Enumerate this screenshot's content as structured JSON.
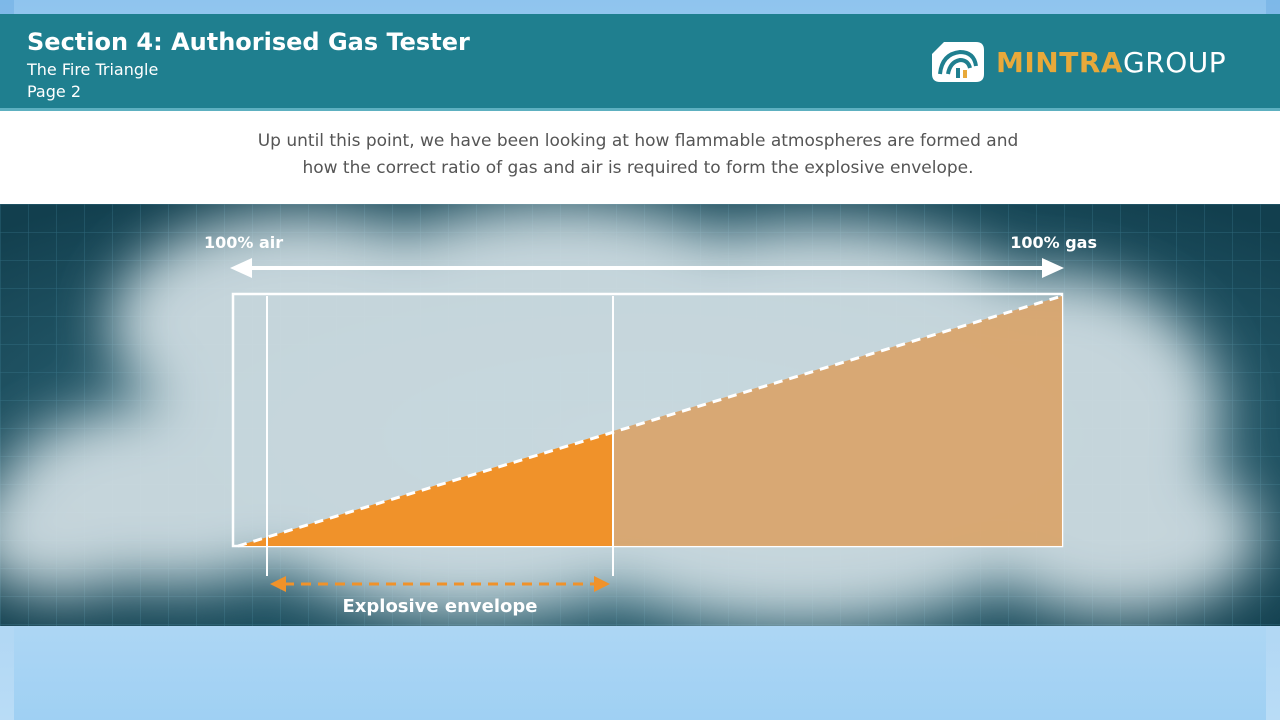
{
  "header": {
    "title": "Section 4: Authorised Gas Tester",
    "subtitle": "The Fire Triangle",
    "page": "Page 2"
  },
  "logo": {
    "part1": "MINTRA",
    "part2": "GROUP",
    "part1_color": "#e8a93a",
    "part2_color": "#ffffff"
  },
  "intro": {
    "line1": "Up until this point, we have been looking at how flammable atmospheres are formed and",
    "line2": "how the correct ratio of gas and air is required to form the explosive envelope."
  },
  "diagram": {
    "left_label": "100% air",
    "right_label": "100% gas",
    "envelope_label": "Explosive envelope",
    "colors": {
      "background": "#1d5566",
      "envelope_fill": "#f0922a",
      "gas_fill": "#d9a46a",
      "envelope_arrow": "#f0922a"
    }
  }
}
